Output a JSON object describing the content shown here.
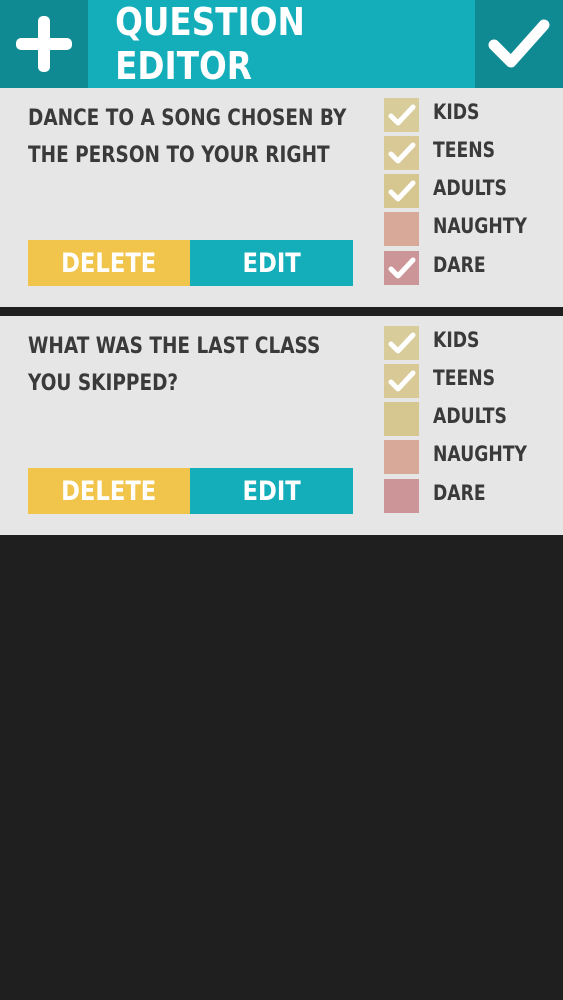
{
  "header": {
    "title": "QUESTION EDITOR",
    "add_icon": "plus-icon",
    "confirm_icon": "checkmark-icon"
  },
  "colors": {
    "accent": "#14aebb",
    "accent_dark": "#0f8a93",
    "delete": "#f1c44b",
    "background": "#201f20",
    "card": "#e6e6e6"
  },
  "questions": [
    {
      "text": "DANCE TO A SONG CHOSEN BY THE PERSON TO YOUR RIGHT",
      "delete_label": "DELETE",
      "edit_label": "EDIT",
      "categories": [
        {
          "label": "KIDS",
          "checked": true
        },
        {
          "label": "TEENS",
          "checked": true
        },
        {
          "label": "ADULTS",
          "checked": true
        },
        {
          "label": "NAUGHTY",
          "checked": false
        },
        {
          "label": "DARE",
          "checked": true
        }
      ]
    },
    {
      "text": "WHAT WAS THE LAST CLASS YOU SKIPPED?",
      "delete_label": "DELETE",
      "edit_label": "EDIT",
      "categories": [
        {
          "label": "KIDS",
          "checked": true
        },
        {
          "label": "TEENS",
          "checked": true
        },
        {
          "label": "ADULTS",
          "checked": false
        },
        {
          "label": "NAUGHTY",
          "checked": false
        },
        {
          "label": "DARE",
          "checked": false
        }
      ]
    }
  ]
}
